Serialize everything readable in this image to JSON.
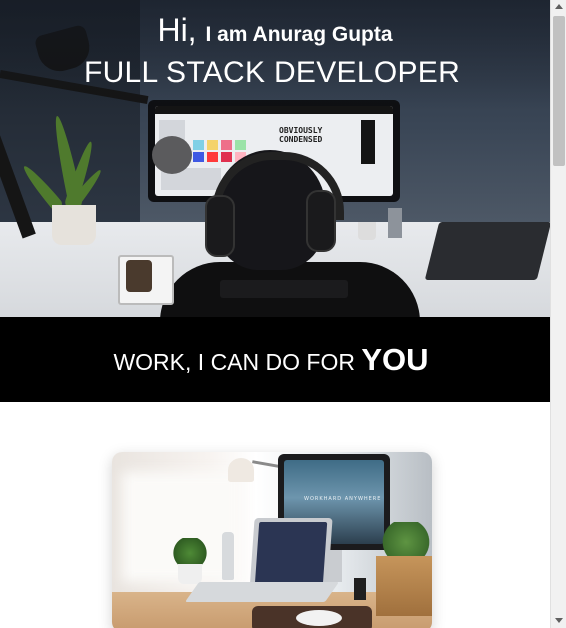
{
  "hero": {
    "greeting": "Hi,",
    "intro": "I am Anurag Gupta",
    "role": "FULL STACK DEVELOPER",
    "screen_text": "OBVIOUSLY CONDENSED"
  },
  "work_section": {
    "title": "WORK, I CAN DO FOR",
    "emphasis": "YOU"
  },
  "card": {
    "screen_text": "WORKHARD ANYWHERE"
  },
  "colors": {
    "band": "#000000",
    "text_light": "#ffffff",
    "page_bg": "#ffffff"
  }
}
